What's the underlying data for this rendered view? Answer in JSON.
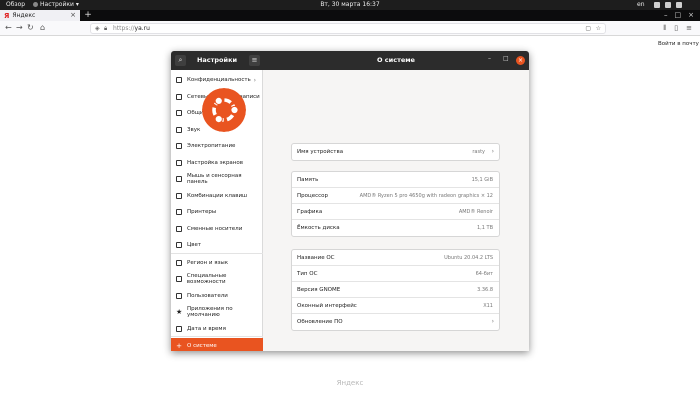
{
  "topbar": {
    "overview": "Обзор",
    "app_name": "Настройки",
    "clock": "Вт, 30 марта  16:37",
    "lang": "en"
  },
  "browser": {
    "tab_title": "Яндекс",
    "tab_favicon": "Я",
    "url_proto": "https://",
    "url_host": "ya.ru"
  },
  "page": {
    "login_link": "Войти в почту",
    "footer_logo": "Яндекс"
  },
  "settings": {
    "sidebar_title": "Настройки",
    "main_title": "О системе",
    "accent_color": "#e95420",
    "sidebar": [
      {
        "label": "Конфиденциальность",
        "icon": "privacy-icon",
        "chevron": true
      },
      {
        "label": "Сетевые учётные записи",
        "icon": "online-accounts-icon"
      },
      {
        "label": "Общий доступ",
        "icon": "sharing-icon"
      },
      {
        "label": "Звук",
        "icon": "sound-icon"
      },
      {
        "label": "Электропитание",
        "icon": "power-icon"
      },
      {
        "label": "Настройка экранов",
        "icon": "displays-icon"
      },
      {
        "label": "Мышь и сенсорная панель",
        "icon": "mouse-icon"
      },
      {
        "label": "Комбинации клавиш",
        "icon": "keyboard-icon"
      },
      {
        "label": "Принтеры",
        "icon": "printer-icon"
      },
      {
        "label": "Сменные носители",
        "icon": "removable-media-icon"
      },
      {
        "label": "Цвет",
        "icon": "color-icon"
      },
      {
        "label": "Регион и язык",
        "icon": "region-icon"
      },
      {
        "label": "Специальные возможности",
        "icon": "accessibility-icon"
      },
      {
        "label": "Пользователи",
        "icon": "users-icon"
      },
      {
        "label": "Приложения по умолчанию",
        "icon": "star-icon"
      },
      {
        "label": "Дата и время",
        "icon": "clock-icon"
      },
      {
        "label": "О системе",
        "icon": "plus-icon",
        "active": true
      }
    ],
    "device": {
      "label": "Имя устройства",
      "value": "rasty"
    },
    "hardware": [
      {
        "label": "Память",
        "value": "15,1 GiB"
      },
      {
        "label": "Процессор",
        "value": "AMD® Ryzen 5 pro 4650g with radeon graphics × 12"
      },
      {
        "label": "Графика",
        "value": "AMD® Renoir"
      },
      {
        "label": "Ёмкость диска",
        "value": "1,1 TB"
      }
    ],
    "software": [
      {
        "label": "Название ОС",
        "value": "Ubuntu 20.04.2 LTS"
      },
      {
        "label": "Тип ОС",
        "value": "64-бит"
      },
      {
        "label": "Версия GNOME",
        "value": "3.36.8"
      },
      {
        "label": "Оконный интерфейс",
        "value": "X11"
      },
      {
        "label": "Обновление ПО",
        "value": "",
        "chevron": true
      }
    ]
  }
}
